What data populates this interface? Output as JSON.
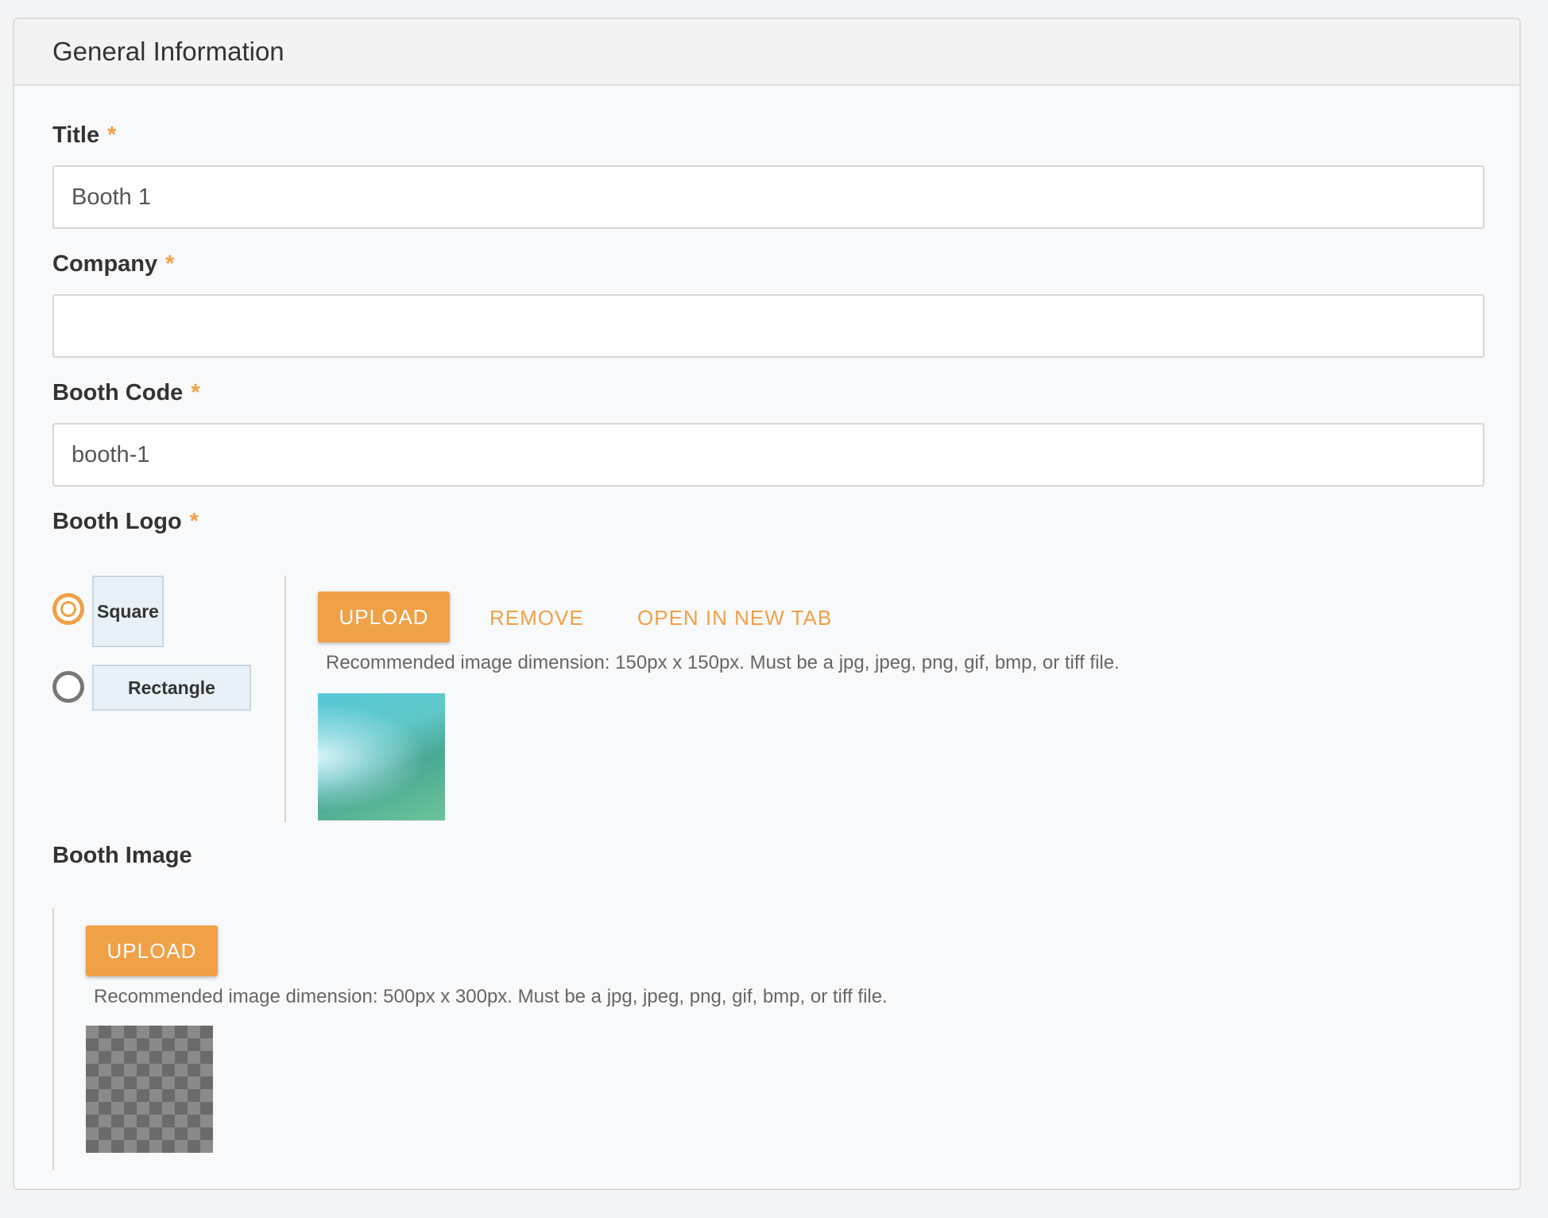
{
  "section": {
    "title": "General Information"
  },
  "fields": {
    "title": {
      "label": "Title",
      "required": "*",
      "value": "Booth 1"
    },
    "company": {
      "label": "Company",
      "required": "*",
      "value": ""
    },
    "booth_code": {
      "label": "Booth Code",
      "required": "*",
      "value": "booth-1"
    }
  },
  "booth_logo": {
    "label": "Booth Logo",
    "required": "*",
    "shape_options": [
      {
        "label": "Square",
        "selected": true
      },
      {
        "label": "Rectangle",
        "selected": false
      }
    ],
    "upload_label": "UPLOAD",
    "remove_label": "REMOVE",
    "open_label": "OPEN IN NEW TAB",
    "hint": "Recommended image dimension: 150px x 150px. Must be a jpg, jpeg, png, gif, bmp, or tiff file."
  },
  "booth_image": {
    "label": "Booth Image",
    "upload_label": "UPLOAD",
    "hint": "Recommended image dimension: 500px x 300px. Must be a jpg, jpeg, png, gif, bmp, or tiff file."
  },
  "colors": {
    "accent": "#f0a046",
    "background": "#f8f9fa"
  }
}
